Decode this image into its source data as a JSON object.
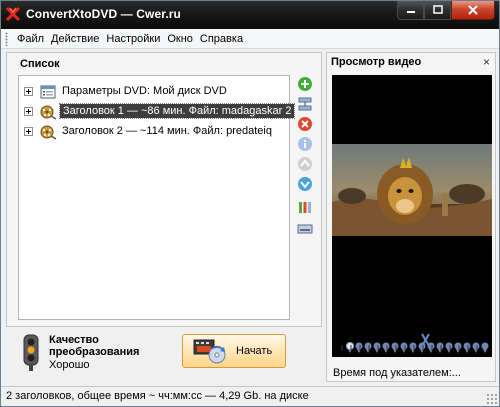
{
  "window": {
    "title": "ConvertXtoDVD — Cwer.ru"
  },
  "menu": {
    "items": [
      "Файл",
      "Действие",
      "Настройки",
      "Окно",
      "Справка"
    ]
  },
  "list_panel": {
    "title": "Список",
    "rows": [
      {
        "label": "Параметры DVD: Мой диск DVD",
        "icon": "dvd-settings-icon",
        "selected": false
      },
      {
        "label": "Заголовок 1  — ~86 мин. Файл: madagaskar 2",
        "icon": "title-reel-icon",
        "selected": true
      },
      {
        "label": "Заголовок 2  — ~114 мин. Файл: predateiq",
        "icon": "title-reel-icon",
        "selected": false
      }
    ],
    "tools": [
      "add-icon",
      "merge-icon",
      "remove-icon",
      "info-icon",
      "move-up-icon",
      "move-down-icon",
      "trim-icon",
      "subtitles-icon"
    ]
  },
  "preview_panel": {
    "title": "Просмотр видео",
    "close": "×",
    "pointer_time_label": "Время под указателем:..."
  },
  "quality": {
    "label_line1": "Качество",
    "label_line2": "преобразования",
    "value": "Хорошо"
  },
  "start_button": {
    "label": "Начать"
  },
  "status": {
    "text": "2 заголовков, общее время ~ чч:мм:сс — 4,29 Gb. на диске"
  },
  "colors": {
    "titlebar": "#111111",
    "selected_row": "#3d3d3d",
    "start_button": "#ffe0a0",
    "close_button": "#c9462c"
  }
}
